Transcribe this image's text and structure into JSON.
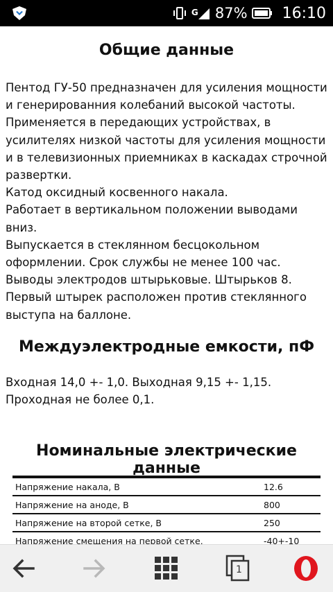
{
  "status_bar": {
    "battery_percent": "87%",
    "time": "16:10",
    "network_label": "G",
    "icons": [
      "app-shield-icon",
      "vibrate-icon",
      "signal-icon",
      "battery-icon"
    ]
  },
  "article": {
    "heading_general": "Общие данные",
    "general_lines": [
      "Пентод ГУ-50 предназначен для усиления мощности и генерированния колебаний высокой частоты.",
      "Применяется в передающих устройствах, в усилителях низкой частоты для усиления мощности и в телевизионных приемниках в каскадах строчной развертки.",
      "Катод оксидный косвенного накала.",
      "Работает в вертикальном положении выводами вниз.",
      "Выпускается в стеклянном бесцокольном оформлении. Срок службы не менее 100 час.",
      "Выводы электродов штырьковые. Штырьков 8.",
      "Первый штырек расположен против стеклянного выступа на баллоне."
    ],
    "heading_capacitance": "Междуэлектродные емкости, пФ",
    "capacitance_text": "Входная 14,0 +- 1,0. Выходная 9,15 +- 1,15. Проходная не более 0,1.",
    "heading_nominal": "Номинальные электрические данные",
    "nominal_table": [
      {
        "label": "Напряжение накала, В",
        "value": "12.6"
      },
      {
        "label": "Напряжение на аноде, В",
        "value": "800"
      },
      {
        "label": "Напряжение на второй сетке, В",
        "value": "250"
      },
      {
        "label": "Напряжение смещения на первой сетке, В",
        "value": "-40+-10"
      }
    ]
  },
  "navbar": {
    "tab_count": "1",
    "buttons": [
      "back-icon",
      "forward-icon",
      "speed-dial-icon",
      "tabs-icon",
      "opera-menu-icon"
    ]
  }
}
